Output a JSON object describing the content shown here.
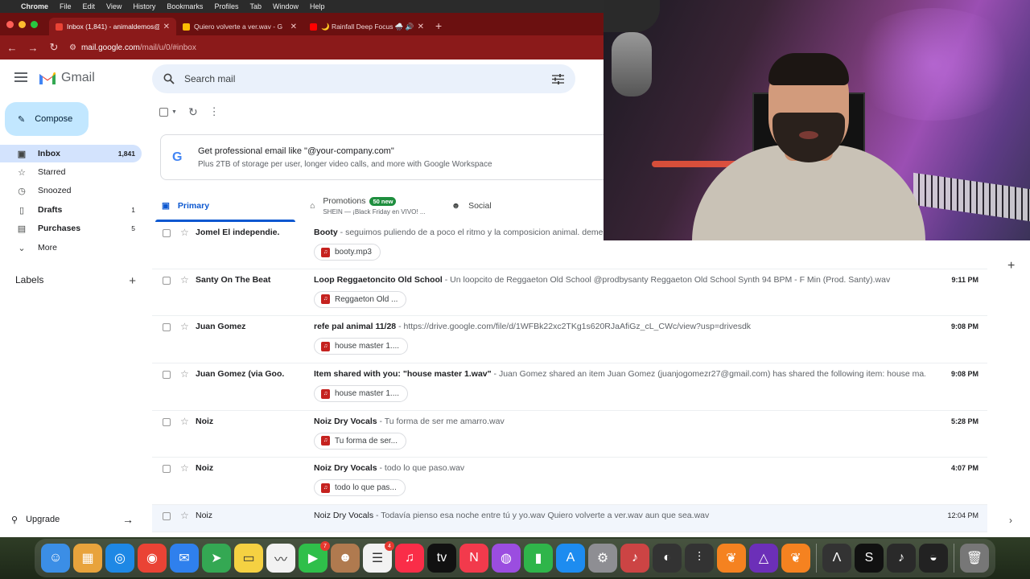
{
  "menubar": {
    "apple": "",
    "items": [
      "Chrome",
      "File",
      "Edit",
      "View",
      "History",
      "Bookmarks",
      "Profiles",
      "Tab",
      "Window",
      "Help"
    ]
  },
  "tabs": [
    {
      "title": "Inbox (1,841) - animaldemos@",
      "favicon_color": "#ea4335"
    },
    {
      "title": "Quiero volverte a ver.wav - G",
      "favicon_color": "#fbbc04"
    },
    {
      "title": "🌙 Rainfall Deep Focus 🌧️ 🔊",
      "favicon_color": "#ff0000"
    }
  ],
  "address": {
    "host": "mail.google.com",
    "path": "/mail/u/0/#inbox"
  },
  "gmail": {
    "wordmark": "Gmail",
    "search_placeholder": "Search mail"
  },
  "sidebar": {
    "compose": "Compose",
    "items": [
      {
        "label": "Inbox",
        "count": "1,841",
        "icon": "inbox-icon",
        "glyph": "▣"
      },
      {
        "label": "Starred",
        "count": "",
        "icon": "star-icon",
        "glyph": "☆"
      },
      {
        "label": "Snoozed",
        "count": "",
        "icon": "clock-icon",
        "glyph": "◷"
      },
      {
        "label": "Drafts",
        "count": "1",
        "icon": "draft-icon",
        "glyph": "▯"
      },
      {
        "label": "Purchases",
        "count": "5",
        "icon": "tag-icon",
        "glyph": "▤"
      },
      {
        "label": "More",
        "count": "",
        "icon": "chevron-down-icon",
        "glyph": "⌄"
      }
    ],
    "labels_heading": "Labels",
    "upgrade": "Upgrade"
  },
  "promo": {
    "title": "Get professional email like \"@your-company.com\"",
    "subtitle": "Plus 2TB of storage per user, longer video calls, and more with Google Workspace"
  },
  "categories": {
    "primary": "Primary",
    "promotions": "Promotions",
    "promotions_badge": "50 new",
    "promotions_snippet": "SHEIN — ¡Black Friday en VIVO! ...",
    "social": "Social"
  },
  "emails": [
    {
      "sender": "Jomel El independie.",
      "subject": "Booty",
      "snippet": " - seguimos puliendo de a poco el ritmo y la composicion animal. deme",
      "time": "",
      "attachment": "booty.mp3"
    },
    {
      "sender": "Santy On The Beat",
      "subject": "Loop Reggaetoncito Old School",
      "snippet": " - Un loopcito de Reggaeton Old School @prodbysanty Reggaeton Old School Synth 94 BPM - F Min (Prod. Santy).wav",
      "time": "9:11 PM",
      "attachment": "Reggaeton Old ..."
    },
    {
      "sender": "Juan Gomez",
      "subject": "refe pal animal 11/28",
      "snippet": " - https://drive.google.com/file/d/1WFBk22xc2TKg1s620RJaAfiGz_cL_CWc/view?usp=drivesdk",
      "time": "9:08 PM",
      "attachment": "house master 1...."
    },
    {
      "sender": "Juan Gomez (via Goo.",
      "subject": "Item shared with you: \"house master 1.wav\"",
      "snippet": " - Juan Gomez shared an item Juan Gomez (juanjogomezr27@gmail.com) has shared the following item: house ma...",
      "time": "9:08 PM",
      "attachment": "house master 1...."
    },
    {
      "sender": "Noiz",
      "subject": "Noiz Dry Vocals",
      "snippet": " - Tu forma de ser me amarro.wav",
      "time": "5:28 PM",
      "attachment": "Tu forma de ser..."
    },
    {
      "sender": "Noiz",
      "subject": "Noiz Dry Vocals",
      "snippet": " - todo lo que paso.wav",
      "time": "4:07 PM",
      "attachment": "todo lo que pas..."
    },
    {
      "sender": "Noiz",
      "subject": "Noiz Dry Vocals",
      "snippet": " - Todavía pienso esa noche entre tú y yo.wav Quiero volverte a ver.wav aun que sea.wav",
      "time": "12:04 PM",
      "attachment": ""
    }
  ],
  "dock": [
    {
      "name": "finder-icon",
      "color": "#3b8ee6",
      "glyph": "☺",
      "badge": ""
    },
    {
      "name": "launchpad-icon",
      "color": "#e8a33c",
      "glyph": "▦",
      "badge": ""
    },
    {
      "name": "safari-icon",
      "color": "#1e88e5",
      "glyph": "◎",
      "badge": ""
    },
    {
      "name": "chrome-icon",
      "color": "#ea4335",
      "glyph": "◉",
      "badge": ""
    },
    {
      "name": "mail-icon",
      "color": "#2f80ed",
      "glyph": "✉",
      "badge": ""
    },
    {
      "name": "maps-icon",
      "color": "#34a853",
      "glyph": "➤",
      "badge": ""
    },
    {
      "name": "notes-icon",
      "color": "#f5d142",
      "glyph": "▭",
      "badge": ""
    },
    {
      "name": "freeform-icon",
      "color": "#f2f2f2",
      "glyph": "〰",
      "badge": ""
    },
    {
      "name": "facetime-icon",
      "color": "#2fbf4a",
      "glyph": "▶",
      "badge": "7"
    },
    {
      "name": "contacts-icon",
      "color": "#b07a4f",
      "glyph": "☻",
      "badge": ""
    },
    {
      "name": "reminders-icon",
      "color": "#f2f2f2",
      "glyph": "☰",
      "badge": "4"
    },
    {
      "name": "music-icon",
      "color": "#fa2d48",
      "glyph": "♫",
      "badge": ""
    },
    {
      "name": "tv-icon",
      "color": "#111111",
      "glyph": "tv",
      "badge": ""
    },
    {
      "name": "news-icon",
      "color": "#f23a4c",
      "glyph": "N",
      "badge": ""
    },
    {
      "name": "podcasts-icon",
      "color": "#9b4de0",
      "glyph": "◍",
      "badge": ""
    },
    {
      "name": "numbers-icon",
      "color": "#2fb54a",
      "glyph": "▮",
      "badge": ""
    },
    {
      "name": "app-store-icon",
      "color": "#1d8cf0",
      "glyph": "A",
      "badge": ""
    },
    {
      "name": "system-settings-icon",
      "color": "#8e8e93",
      "glyph": "⚙",
      "badge": ""
    },
    {
      "name": "music-app-icon",
      "color": "#c44",
      "glyph": "♪",
      "badge": ""
    },
    {
      "name": "audio-app-icon",
      "color": "#333",
      "glyph": "◐",
      "badge": ""
    },
    {
      "name": "mixer-icon",
      "color": "#333",
      "glyph": "⫶",
      "badge": ""
    },
    {
      "name": "fl-studio-icon",
      "color": "#f58220",
      "glyph": "❦",
      "badge": ""
    },
    {
      "name": "ableton-icon",
      "color": "#6c2fb8",
      "glyph": "△",
      "badge": ""
    },
    {
      "name": "fl-studio-alt-icon",
      "color": "#f58220",
      "glyph": "❦",
      "badge": ""
    },
    {
      "name": "apogee-icon",
      "color": "#333",
      "glyph": "Λ",
      "badge": ""
    },
    {
      "name": "splice-icon",
      "color": "#111",
      "glyph": "S",
      "badge": ""
    },
    {
      "name": "blank-app-icon",
      "color": "#2a2a2a",
      "glyph": "♪",
      "badge": ""
    },
    {
      "name": "obs-icon",
      "color": "#222",
      "glyph": "◒",
      "badge": ""
    },
    {
      "name": "trash-icon",
      "color": "#777",
      "glyph": "🗑",
      "badge": ""
    }
  ]
}
